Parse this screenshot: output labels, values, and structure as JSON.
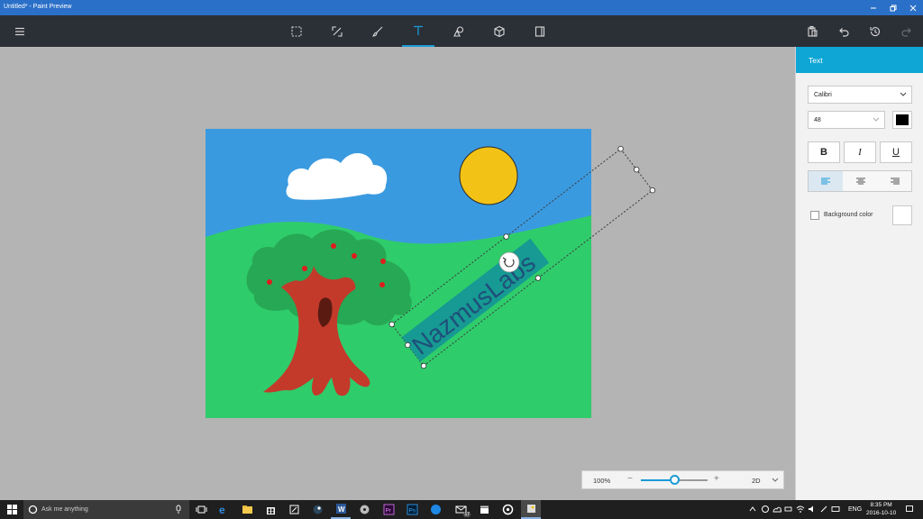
{
  "window": {
    "title": "Untitled* - Paint Preview"
  },
  "toolbar": {
    "items": [
      "menu-icon",
      "select-icon",
      "crop-icon",
      "brush-icon",
      "text-icon",
      "shapes-icon",
      "3d-object-icon",
      "canvas-icon"
    ],
    "active": "text-icon",
    "accent": "#1a9ad6"
  },
  "canvas": {
    "text_object": {
      "content": "NazmusLabs",
      "fill": "#169a93",
      "text_color": "#1f4f7a"
    }
  },
  "panel": {
    "title": "Text",
    "font_family": "Calibri",
    "font_size": "48",
    "font_color": "#000000",
    "bold_label": "B",
    "italic_label": "I",
    "underline_label": "U",
    "alignment": "left",
    "background_color_label": "Background color",
    "background_color_checked": false
  },
  "zoom": {
    "percent": "100%",
    "minus": "−",
    "plus": "+",
    "mode": "2D",
    "slider_fraction": 0.5
  },
  "taskbar": {
    "search_placeholder": "Ask me anything",
    "lang": "ENG",
    "time": "8:35 PM",
    "date": "2016-10-10",
    "mail_badge": "17"
  }
}
